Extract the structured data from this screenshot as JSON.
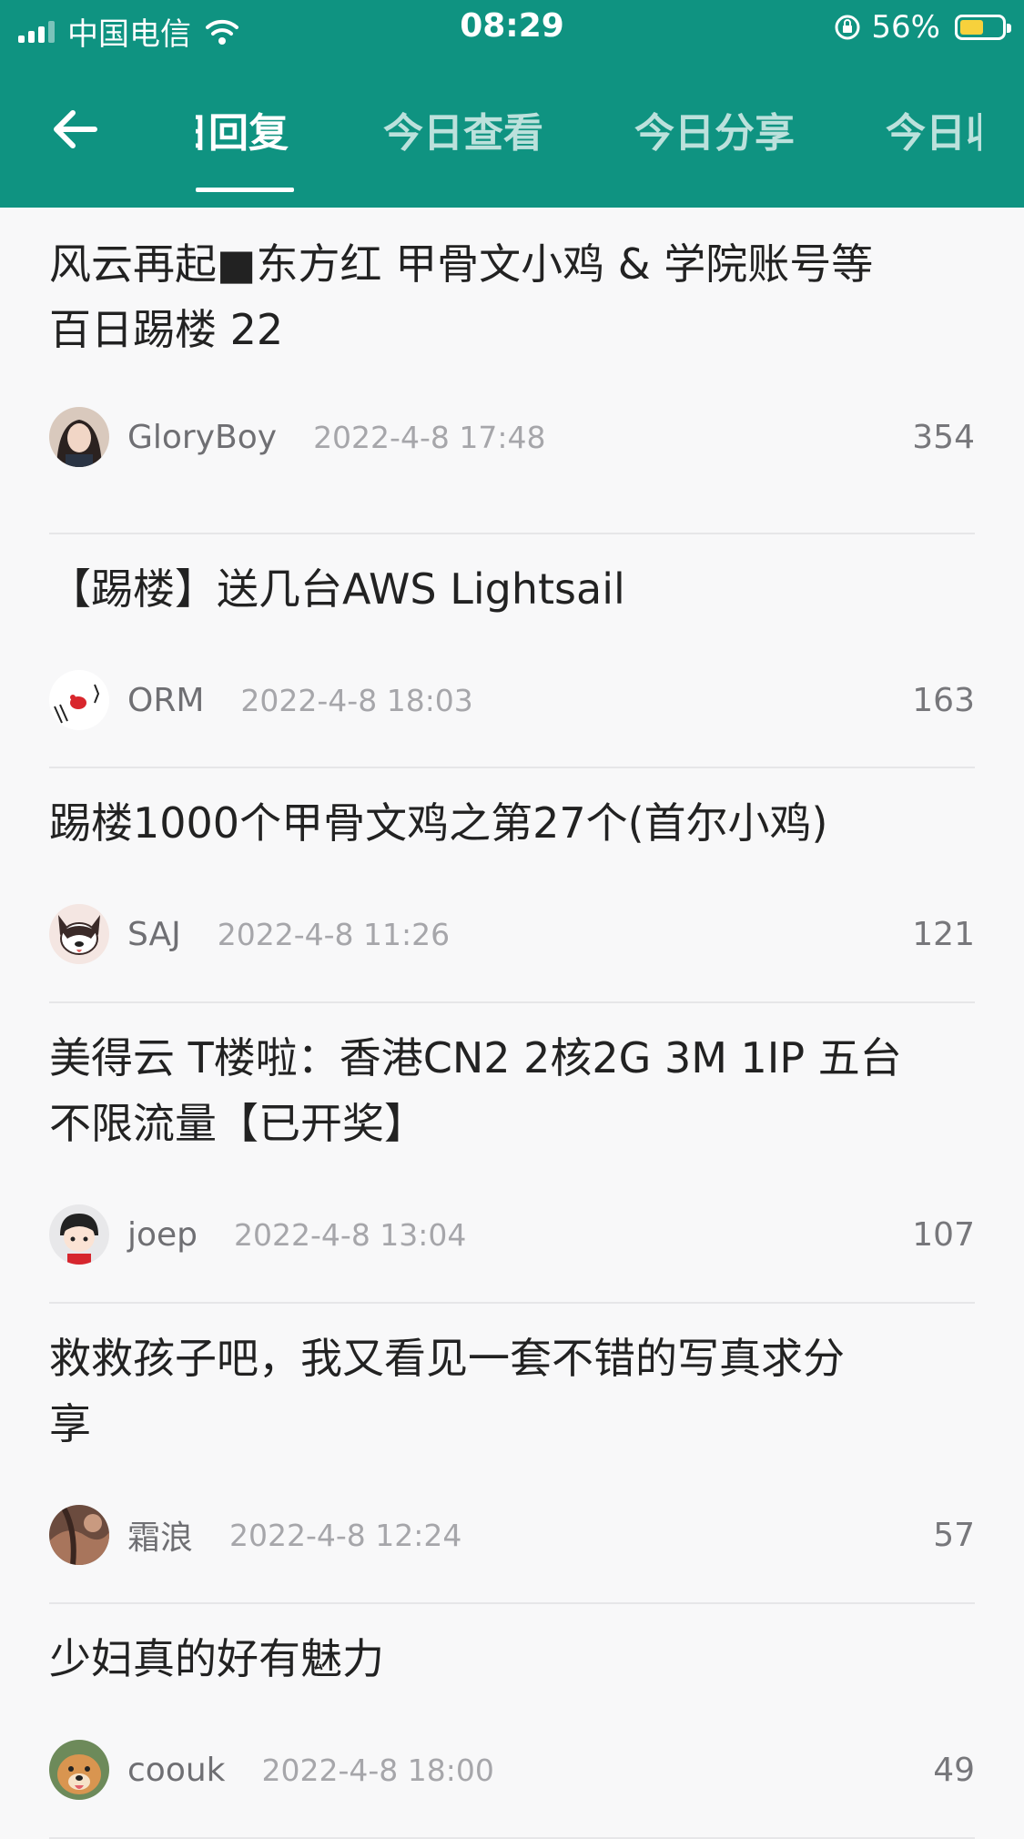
{
  "status_bar": {
    "carrier": "中国电信",
    "time": "08:29",
    "battery": "56%",
    "battery_level": 0.56
  },
  "tabs": [
    {
      "label": "回复",
      "partial_prefix": "日"
    },
    {
      "label": "今日查看"
    },
    {
      "label": "今日分享"
    },
    {
      "label": "今日收"
    }
  ],
  "active_tab": 0,
  "icons": {
    "back": "back-arrow-icon",
    "signal": "signal-icon",
    "wifi": "wifi-icon",
    "rotation_lock": "rotation-lock-icon",
    "battery": "battery-icon"
  },
  "colors": {
    "header": "#0f9381",
    "battery_fill": "#f7d13c"
  },
  "posts": [
    {
      "title_lines": [
        "风云再起■东方红 甲骨文小鸡 & 学院账号等",
        "百日踢楼 22"
      ],
      "author": "GloryBoy",
      "date": "2022-4-8 17:48",
      "count": "354"
    },
    {
      "title_lines": [
        "【踢楼】送几台AWS Lightsail"
      ],
      "author": "ORM",
      "date": "2022-4-8 18:03",
      "count": "163"
    },
    {
      "title_lines": [
        "踢楼1000个甲骨文鸡之第27个(首尔小鸡)"
      ],
      "author": "SAJ",
      "date": "2022-4-8 11:26",
      "count": "121"
    },
    {
      "title_lines": [
        "美得云 T楼啦：香港CN2 2核2G 3M 1IP 五台",
        "不限流量【已开奖】"
      ],
      "author": "joep",
      "date": "2022-4-8 13:04",
      "count": "107"
    },
    {
      "title_lines": [
        "救救孩子吧，我又看见一套不错的写真求分",
        "享"
      ],
      "author": "霜浪",
      "date": "2022-4-8 12:24",
      "count": "57"
    },
    {
      "title_lines": [
        "少妇真的好有魅力"
      ],
      "author": "coouk",
      "date": "2022-4-8 18:00",
      "count": "49"
    }
  ]
}
